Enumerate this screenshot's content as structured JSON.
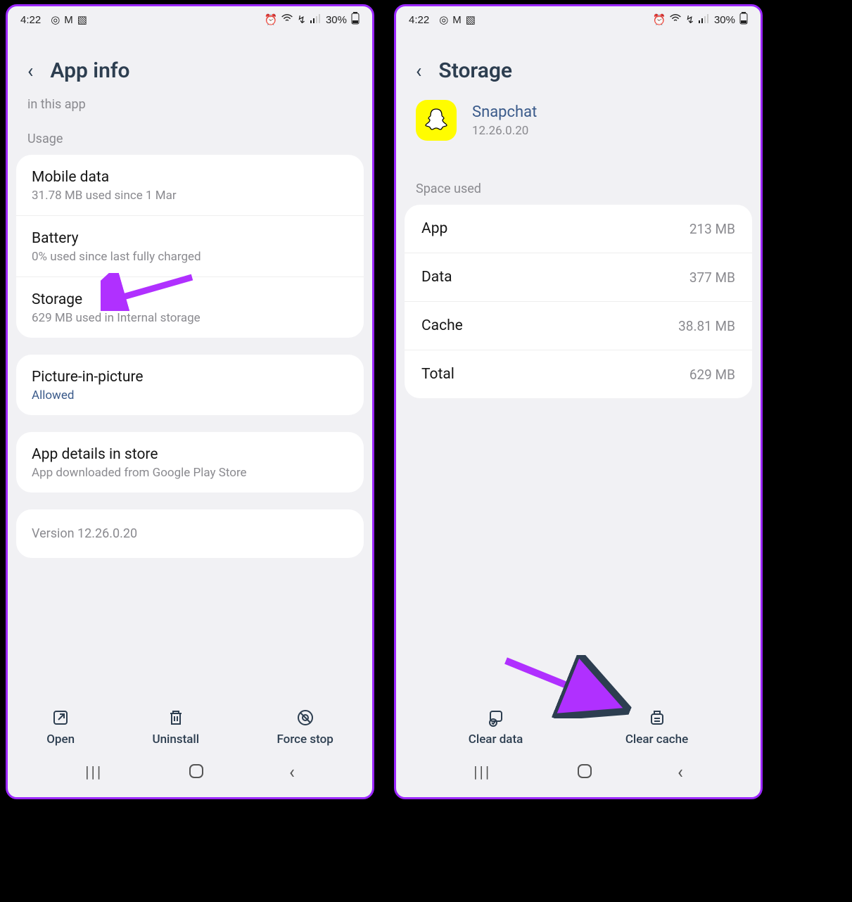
{
  "status": {
    "time": "4:22",
    "battery_pct": "30%"
  },
  "left": {
    "title": "App info",
    "cutoff_text": "in this app",
    "section_usage": "Usage",
    "rows": {
      "mobile_data": {
        "title": "Mobile data",
        "sub": "31.78 MB used since 1 Mar"
      },
      "battery": {
        "title": "Battery",
        "sub": "0% used since last fully charged"
      },
      "storage": {
        "title": "Storage",
        "sub": "629 MB used in Internal storage"
      },
      "pip": {
        "title": "Picture-in-picture",
        "sub": "Allowed"
      },
      "store": {
        "title": "App details in store",
        "sub": "App downloaded from Google Play Store"
      }
    },
    "version": "Version 12.26.0.20",
    "actions": {
      "open": "Open",
      "uninstall": "Uninstall",
      "force_stop": "Force stop"
    }
  },
  "right": {
    "title": "Storage",
    "app": {
      "name": "Snapchat",
      "version": "12.26.0.20"
    },
    "section_space": "Space used",
    "rows": {
      "app": {
        "key": "App",
        "val": "213 MB"
      },
      "data": {
        "key": "Data",
        "val": "377 MB"
      },
      "cache": {
        "key": "Cache",
        "val": "38.81 MB"
      },
      "total": {
        "key": "Total",
        "val": "629 MB"
      }
    },
    "actions": {
      "clear_data": "Clear data",
      "clear_cache": "Clear cache"
    }
  }
}
